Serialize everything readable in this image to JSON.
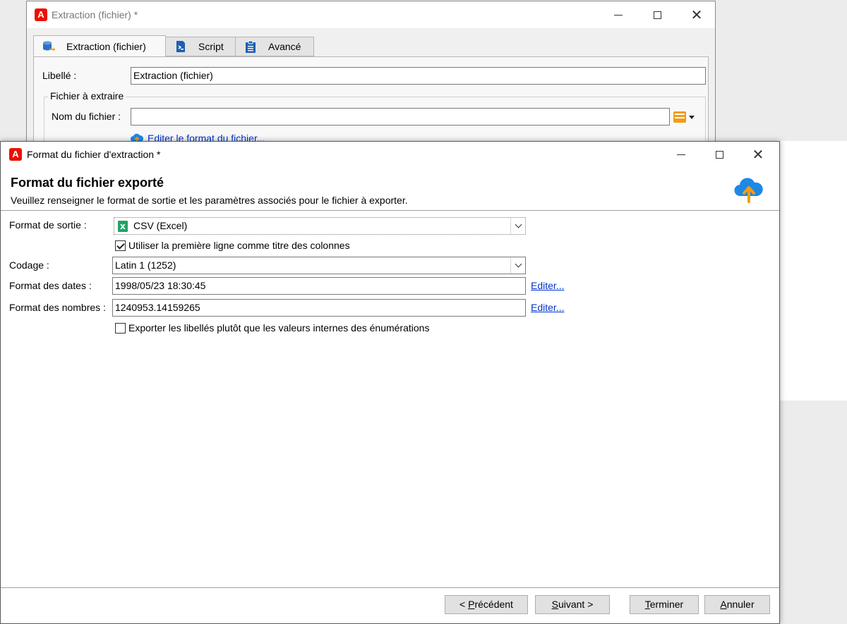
{
  "back_window": {
    "title": "Extraction (fichier) *",
    "tabs": [
      {
        "label": "Extraction (fichier)",
        "icon": "database-export-icon"
      },
      {
        "label": "Script",
        "icon": "script-icon"
      },
      {
        "label": "Avancé",
        "icon": "clipboard-icon"
      }
    ],
    "libelle_label": "Libellé :",
    "libelle_value": "Extraction (fichier)",
    "group_title": "Fichier à extraire",
    "filename_label": "Nom du fichier :",
    "filename_value": "",
    "edit_format_link": "Editer le format du fichier..."
  },
  "dialog": {
    "title": "Format du fichier d'extraction *",
    "header_title": "Format du fichier exporté",
    "header_subtitle": "Veuillez renseigner le format de sortie et les paramètres associés pour le fichier à exporter.",
    "output_format_label": "Format de sortie :",
    "output_format_value": "CSV (Excel)",
    "first_line_checkbox_label": "Utiliser la première ligne comme titre des colonnes",
    "first_line_checked": true,
    "encoding_label": "Codage :",
    "encoding_value": "Latin 1 (1252)",
    "date_format_label": "Format des dates :",
    "date_format_value": "1998/05/23 18:30:45",
    "number_format_label": "Format des nombres :",
    "number_format_value": "1240953.14159265",
    "edit_link": "Editer...",
    "export_labels_checkbox_label": "Exporter les libellés plutôt que les valeurs internes des énumérations",
    "export_labels_checked": false,
    "buttons": {
      "previous": {
        "pre": "< ",
        "mnemonic": "P",
        "rest": "récédent"
      },
      "next": {
        "mnemonic": "S",
        "rest": "uivant >"
      },
      "finish": {
        "mnemonic": "T",
        "rest": "erminer"
      },
      "cancel": {
        "mnemonic": "A",
        "rest": "nnuler"
      }
    }
  },
  "colors": {
    "adobe_red": "#eb1000",
    "link_blue": "#0033cc",
    "cloud_blue": "#1e88e5",
    "upload_orange": "#f39c12",
    "excel_green": "#21a366"
  }
}
